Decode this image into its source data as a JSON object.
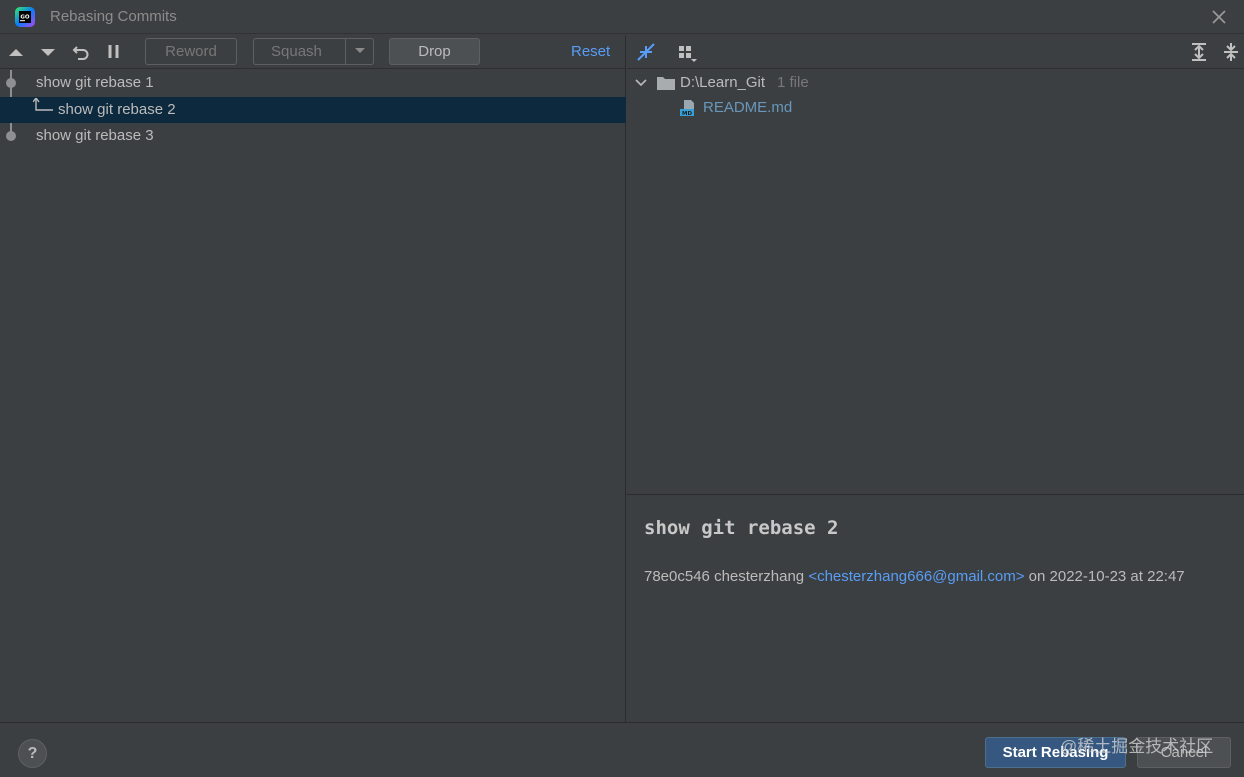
{
  "window": {
    "title": "Rebasing Commits",
    "logo_text": "GO"
  },
  "toolbar": {
    "reword_label": "Reword",
    "squash_label": "Squash",
    "drop_label": "Drop",
    "reset_label": "Reset"
  },
  "commits": [
    {
      "message": "show git rebase 1"
    },
    {
      "message": "show git rebase 2",
      "selected": true
    },
    {
      "message": "show git rebase 3"
    }
  ],
  "changes_tree": {
    "folder": "D:\\Learn_Git",
    "file_count": "1 file",
    "files": [
      {
        "name": "README.md",
        "badge": "MD"
      }
    ]
  },
  "details": {
    "title": "show git rebase 2",
    "hash": "78e0c546",
    "author": "chesterzhang",
    "email": "<chesterzhang666@gmail.com>",
    "date_text": "on 2022-10-23 at 22:47"
  },
  "footer": {
    "help_label": "?",
    "start_label": "Start Rebasing",
    "cancel_label": "Cancel",
    "watermark": "@稀土掘金技术社区"
  },
  "colors": {
    "accent_link": "#589df6",
    "selection": "#0d293e",
    "primary_button": "#365880"
  }
}
